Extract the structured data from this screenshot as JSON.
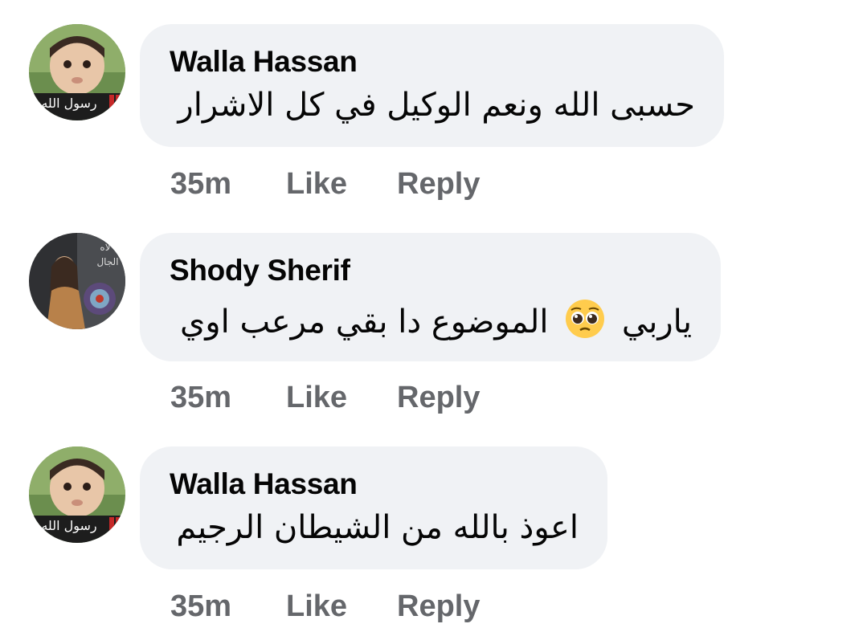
{
  "comments": [
    {
      "author": "Walla Hassan",
      "text": "حسبى الله ونعم الوكيل في كل الاشرار",
      "avatar_icon": "baby-photo-avatar",
      "time": "35m",
      "like": "Like",
      "reply": "Reply"
    },
    {
      "author": "Shody Sherif",
      "text_before_emoji": "ياربي",
      "text_after_emoji": "الموضوع دا بقي مرعب اوي",
      "emoji": "pleading-face-emoji",
      "avatar_icon": "woman-photo-avatar",
      "time": "35m",
      "like": "Like",
      "reply": "Reply"
    },
    {
      "author": "Walla Hassan",
      "text": "اعوذ بالله من الشيطان الرجيم",
      "avatar_icon": "baby-photo-avatar",
      "time": "35m",
      "like": "Like",
      "reply": "Reply"
    }
  ],
  "colors": {
    "bubble": "#f0f2f5",
    "text": "#050505",
    "meta": "#65676b"
  }
}
